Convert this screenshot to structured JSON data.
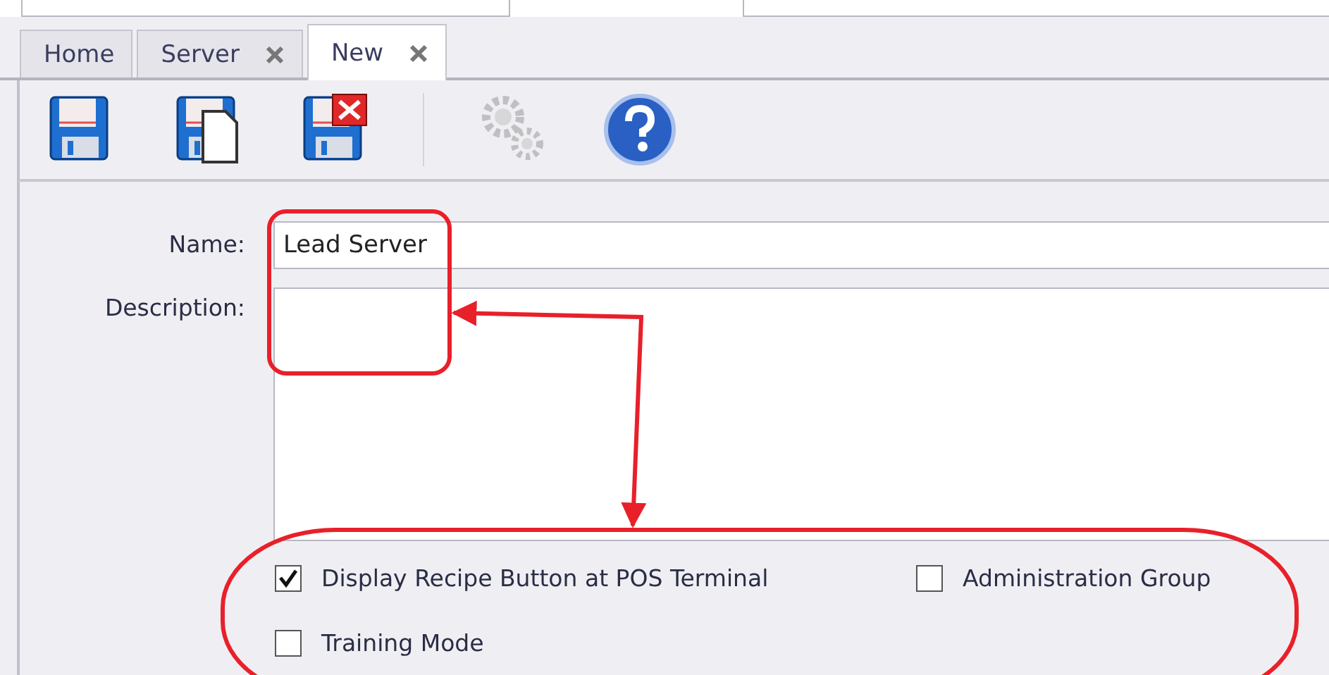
{
  "tabs": [
    {
      "label": "Home",
      "closable": false,
      "selected": false
    },
    {
      "label": "Server",
      "closable": true,
      "selected": false
    },
    {
      "label": "New",
      "closable": true,
      "selected": true
    }
  ],
  "toolbar": [
    {
      "kind": "save",
      "disabled": false
    },
    {
      "kind": "save-new",
      "disabled": false
    },
    {
      "kind": "save-close",
      "disabled": false
    },
    {
      "kind": "separator"
    },
    {
      "kind": "gears",
      "disabled": true
    },
    {
      "kind": "help",
      "disabled": false
    }
  ],
  "form": {
    "name": {
      "label": "Name:",
      "value": "Lead Server"
    },
    "description": {
      "label": "Description:"
    }
  },
  "checkboxes": [
    {
      "label": "Display Recipe Button at POS Terminal",
      "checked": true
    },
    {
      "label": "Administration Group",
      "checked": false
    },
    {
      "label": "Training Mode",
      "checked": false
    }
  ]
}
